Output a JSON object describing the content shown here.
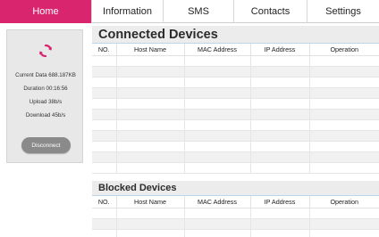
{
  "nav": {
    "items": [
      {
        "label": "Home",
        "active": true
      },
      {
        "label": "Information",
        "active": false
      },
      {
        "label": "SMS",
        "active": false
      },
      {
        "label": "Contacts",
        "active": false
      },
      {
        "label": "Settings",
        "active": false
      }
    ]
  },
  "status": {
    "icon": "refresh-icon",
    "current_data": "Current Data 688.187KB",
    "duration": "Duration 00:16:56",
    "upload": "Upload 38b/s",
    "download": "Download 45b/s",
    "disconnect_label": "Disconnect"
  },
  "connected": {
    "title": "Connected Devices",
    "columns": [
      "NO.",
      "Host Name",
      "MAC Address",
      "IP Address",
      "Operation"
    ],
    "rows": []
  },
  "blocked": {
    "title": "Blocked Devices",
    "columns": [
      "NO.",
      "Host Name",
      "MAC Address",
      "IP Address",
      "Operation"
    ],
    "rows": []
  },
  "colors": {
    "accent": "#d9246e",
    "panel_bg": "#e8e8e8",
    "button_bg": "#8a8a8a",
    "refresh_icon": "#d9246e"
  }
}
